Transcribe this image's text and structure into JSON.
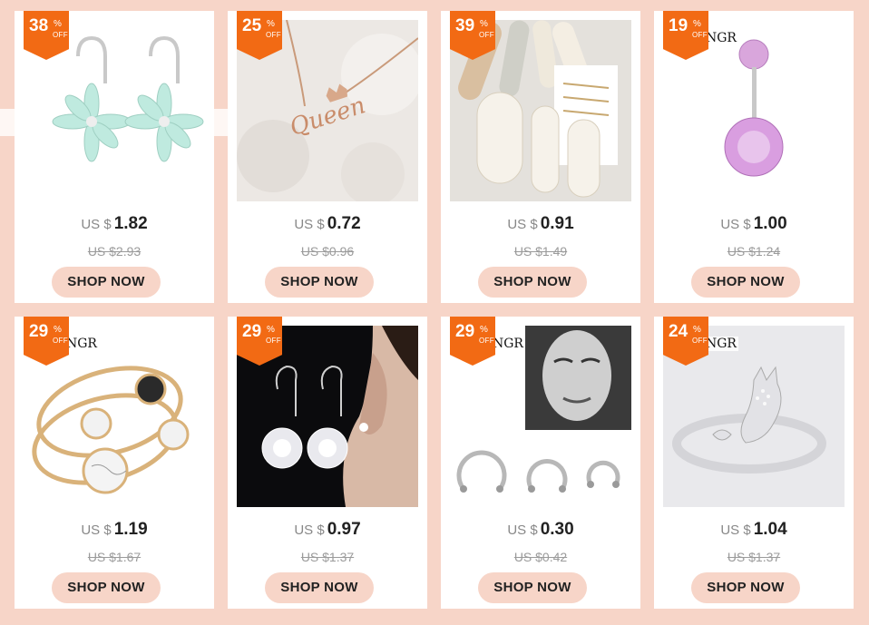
{
  "products": [
    {
      "discount": "38",
      "pct_sign": "%",
      "off": "OFF",
      "currency": "US $",
      "price": "1.82",
      "old_price": "US $2.93",
      "button": "SHOP NOW",
      "image": "opal-flower-hoop-earrings",
      "brand": ""
    },
    {
      "discount": "25",
      "pct_sign": "%",
      "off": "OFF",
      "currency": "US $",
      "price": "0.72",
      "old_price": "US $0.96",
      "button": "SHOP NOW",
      "image": "queen-script-necklace",
      "brand": ""
    },
    {
      "discount": "39",
      "pct_sign": "%",
      "off": "OFF",
      "currency": "US $",
      "price": "0.91",
      "old_price": "US $1.49",
      "button": "SHOP NOW",
      "image": "pearl-hair-clips",
      "brand": ""
    },
    {
      "discount": "19",
      "pct_sign": "%",
      "off": "OFF",
      "currency": "US $",
      "price": "1.00",
      "old_price": "US $1.24",
      "button": "SHOP NOW",
      "image": "pink-crystal-belly-ring",
      "brand": "NGR"
    },
    {
      "discount": "29",
      "pct_sign": "%",
      "off": "OFF",
      "currency": "US $",
      "price": "1.19",
      "old_price": "US $1.67",
      "button": "SHOP NOW",
      "image": "marble-stone-cuff-bracelets",
      "brand": "NGR"
    },
    {
      "discount": "29",
      "pct_sign": "%",
      "off": "OFF",
      "currency": "US $",
      "price": "0.97",
      "old_price": "US $1.37",
      "button": "SHOP NOW",
      "image": "crystal-drop-hook-earrings",
      "brand": ""
    },
    {
      "discount": "29",
      "pct_sign": "%",
      "off": "OFF",
      "currency": "US $",
      "price": "0.30",
      "old_price": "US $0.42",
      "button": "SHOP NOW",
      "image": "horseshoe-septum-rings",
      "brand": "NGR"
    },
    {
      "discount": "24",
      "pct_sign": "%",
      "off": "OFF",
      "currency": "US $",
      "price": "1.04",
      "old_price": "US $1.37",
      "button": "SHOP NOW",
      "image": "cat-open-ring",
      "brand": "NGR"
    }
  ],
  "colors": {
    "background": "#f7d5c8",
    "badge": "#f26a14",
    "button_bg": "#f7d5c8"
  }
}
